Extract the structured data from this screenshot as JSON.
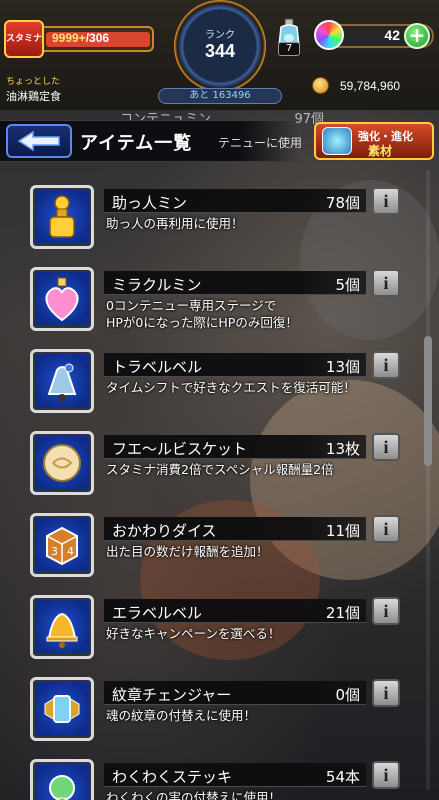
{
  "status": {
    "stamina_label": "スタミナ",
    "stamina_current": "9999+",
    "stamina_max": "/306",
    "title_small": "ちょっとした",
    "title_main": "油淋鶏定食",
    "rank_label": "ランク",
    "rank_value": "344",
    "rank_next": "あと 163496",
    "potion_count": "7",
    "orb_count": "42",
    "coin_count": "59,784,960"
  },
  "header": {
    "ghost_name": "コンテニュミン",
    "ghost_count": "97個",
    "title": "アイテム一覧",
    "subtitle": "テニューに使用",
    "evolve_line1": "強化・進化",
    "evolve_line2": "素材"
  },
  "items": [
    {
      "name": "助っ人ミン",
      "count": "78個",
      "desc": "助っ人の再利用に使用！",
      "icon": "potion-bottle-icon"
    },
    {
      "name": "ミラクルミン",
      "count": "5個",
      "desc": "0コンテニュー専用ステージで\nHPが0になった際にHPのみ回復！",
      "icon": "heart-potion-icon"
    },
    {
      "name": "トラベルベル",
      "count": "13個",
      "desc": "タイムシフトで好きなクエストを復活可能！",
      "icon": "travel-bell-icon"
    },
    {
      "name": "フエ〜ルビスケット",
      "count": "13枚",
      "desc": "スタミナ消費2倍でスペシャル報酬量2倍",
      "icon": "biscuit-icon"
    },
    {
      "name": "おかわりダイス",
      "count": "11個",
      "desc": "出た目の数だけ報酬を追加！",
      "icon": "dice-icon"
    },
    {
      "name": "エラベルベル",
      "count": "21個",
      "desc": "好きなキャンペーンを選べる！",
      "icon": "gold-bell-icon"
    },
    {
      "name": "紋章チェンジャー",
      "count": "0個",
      "desc": "魂の紋章の付替えに使用！",
      "icon": "emblem-changer-icon"
    },
    {
      "name": "わくわくステッキ",
      "count": "54本",
      "desc": "わくわくの実の付替えに使用！",
      "icon": "wand-icon"
    }
  ],
  "colors": {
    "accent_blue": "#0e2c8a",
    "stamina_red": "#d8462f",
    "gold": "#ffce3a"
  }
}
